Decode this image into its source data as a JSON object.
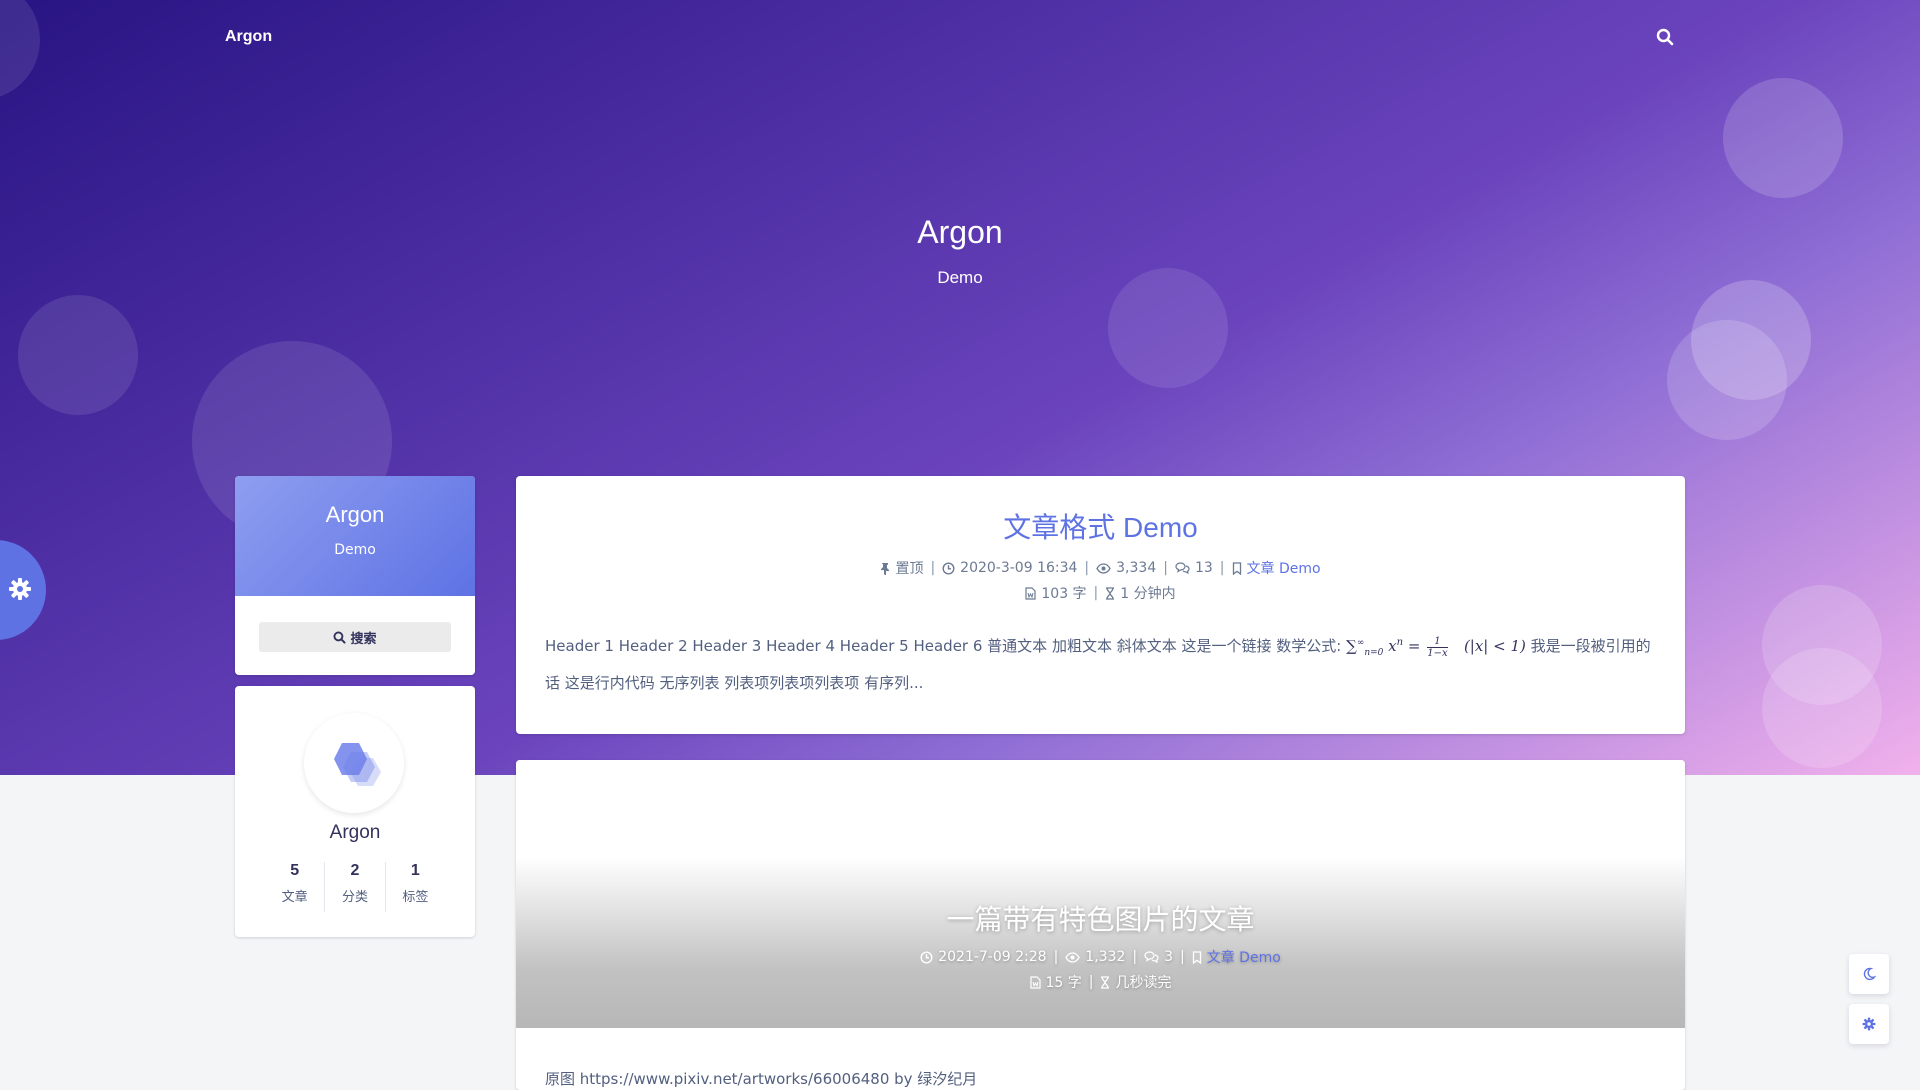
{
  "nav": {
    "brand": "Argon",
    "search_icon": "search-icon"
  },
  "banner": {
    "title": "Argon",
    "subtitle": "Demo"
  },
  "sidebar": {
    "site_title": "Argon",
    "site_subtitle": "Demo",
    "search_label": "搜索",
    "author_name": "Argon",
    "stats": [
      {
        "num": "5",
        "label": "文章"
      },
      {
        "num": "2",
        "label": "分类"
      },
      {
        "num": "1",
        "label": "标签"
      }
    ]
  },
  "posts": [
    {
      "title": "文章格式 Demo",
      "sticky": "置顶",
      "date": "2020-3-09 16:34",
      "views": "3,334",
      "comments": "13",
      "category": "文章 Demo",
      "words": "103 字",
      "read_time": "1 分钟内",
      "excerpt_start": "Header 1 Header 2 Header 3 Header 4 Header 5 Header 6 普通文本 加粗文本 斜体文本 这是一个链接 数学公式:",
      "excerpt_end": "我是一段被引用的话 这是行内代码 无序列表 列表项列表项列表项 有序列...",
      "math": {
        "sum": "∑",
        "sup": "∞",
        "sub": "n=0",
        "term": "x",
        "pow": "n",
        "eq": "=",
        "num": "1",
        "den": "1−x",
        "cond": "(|x| < 1)"
      }
    },
    {
      "title": "一篇带有特色图片的文章",
      "date": "2021-7-09 2:28",
      "views": "1,332",
      "comments": "3",
      "category": "文章 Demo",
      "words": "15 字",
      "read_time": "几秒读完",
      "excerpt": "原图 https://www.pixiv.net/artworks/66006480 by 绿汐纪月"
    }
  ],
  "floating": {
    "dark_mode_icon": "moon-icon",
    "settings_icon": "gear-icon"
  },
  "colors": {
    "accent": "#5e72e4",
    "hero_start": "#281483",
    "hero_end": "#f1b1ec"
  }
}
